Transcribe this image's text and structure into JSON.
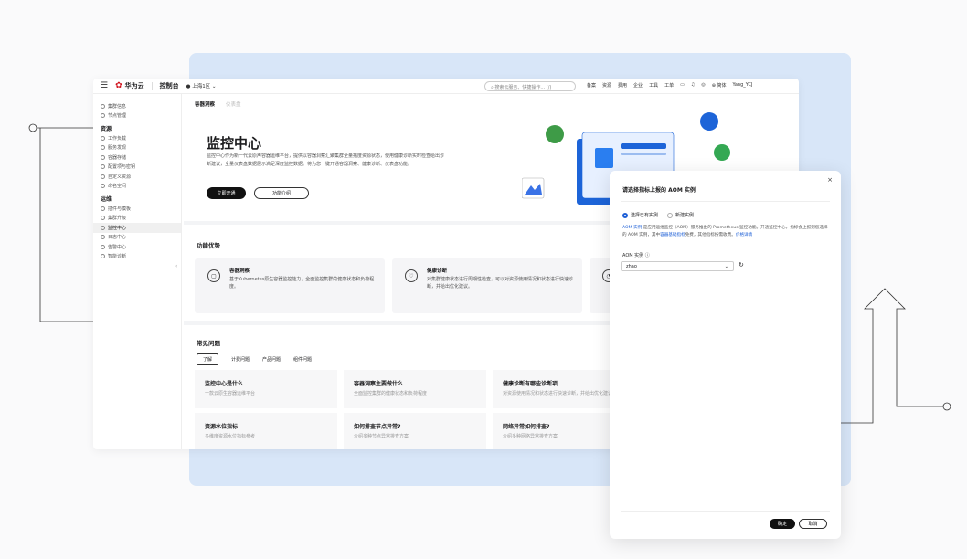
{
  "header": {
    "brand": "华为云",
    "console": "控制台",
    "region": "上海1区",
    "search_placeholder": "搜索云服务、快捷操作... (/)",
    "nav": [
      "备案",
      "资源",
      "费用",
      "企业",
      "工具",
      "工单"
    ],
    "lang": "简体",
    "user": "Yang_YCJ"
  },
  "sidebar": {
    "group1": [
      "集群信息",
      "节点管理"
    ],
    "sec1": "资源",
    "group2": [
      "工作负载",
      "服务发现",
      "容器存储",
      "配置项与密钥",
      "自定义资源",
      "命名空间"
    ],
    "sec2": "运维",
    "group3": [
      "插件与模板",
      "集群升级",
      "监控中心",
      "日志中心",
      "告警中心",
      "智能诊断"
    ]
  },
  "hero": {
    "tab_active": "容器洞察",
    "tab_inactive": "仪表盘",
    "title": "监控中心",
    "desc": "监控中心作为新一代云原声容器运维平台，提供以容器洞察汇聚集群全量拓度资源状态，使用健康诊断实时检查给出诊断建议，全量仪表盘数据展示满足深度监控数据。将为您一键开通容器洞察、健康诊断、仪表盘功能。",
    "btn_primary": "立即开通",
    "btn_secondary": "功能介绍"
  },
  "features": {
    "title": "功能优势",
    "items": [
      {
        "title": "容器洞察",
        "desc": "基于Kubernetes原生容器监控能力，全面监控集群的健康状态和负荷程度。"
      },
      {
        "title": "健康诊断",
        "desc": "对集群健康状态进行周期性检查，可以对资源使用情况和状态进行快速诊断，并给出优化建议。"
      }
    ]
  },
  "faq": {
    "title": "常见问题",
    "tabs": [
      "了解",
      "计费问题",
      "产品问题",
      "组件问题"
    ],
    "items": [
      {
        "q": "监控中心是什么",
        "a": "一款云原生容器运维平台"
      },
      {
        "q": "容器洞察主要做什么",
        "a": "全面监控集群的健康状态和负荷程度"
      },
      {
        "q": "健康诊断有哪些诊断项",
        "a": "对资源使用情况和状态进行快速诊断，并给出优化建议"
      },
      {
        "q": "资源水位指标",
        "a": "多维度资源水位指标参考"
      },
      {
        "q": "如何排查节点异常?",
        "a": "介绍多种节点异常排查方案"
      },
      {
        "q": "网络异常如何排查?",
        "a": "介绍多种网络异常排查方案"
      }
    ]
  },
  "drawer": {
    "title": "请选择指标上报的 AOM 实例",
    "radio_on": "选择已有实例",
    "radio_off": "新建实例",
    "info_link1": "AOM 实例",
    "info_text1": " 是应用运维监控（AOM）服务推出的 Prometheus 监控功能。开通监控中心，指标会上报到您选择的 AOM 实例，其中",
    "info_link2": "容器基础指标",
    "info_text2": "免费，其他指标按需收费。",
    "info_link3": "价格详情",
    "label": "AOM 实例",
    "select_value": "zhao",
    "ok": "确定",
    "cancel": "取消"
  }
}
